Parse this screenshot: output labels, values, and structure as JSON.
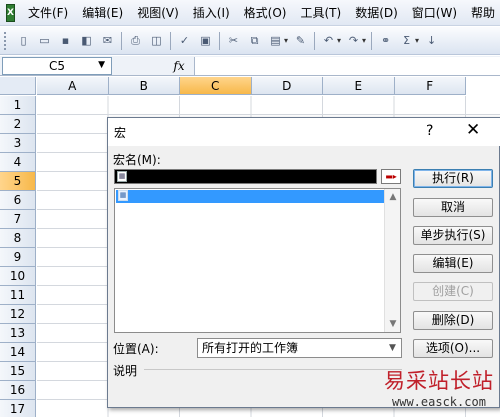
{
  "menubar": {
    "items": [
      "文件(F)",
      "编辑(E)",
      "视图(V)",
      "插入(I)",
      "格式(O)",
      "工具(T)",
      "数据(D)",
      "窗口(W)",
      "帮助"
    ]
  },
  "formula_bar": {
    "name_box": "C5",
    "fx_label": "fx"
  },
  "sheet": {
    "columns": [
      "A",
      "B",
      "C",
      "D",
      "E",
      "F"
    ],
    "rows": [
      "1",
      "2",
      "3",
      "4",
      "5",
      "6",
      "7",
      "8",
      "9",
      "10",
      "11",
      "12",
      "13",
      "14",
      "15",
      "16",
      "17"
    ],
    "active_column": "C",
    "active_row": "5"
  },
  "dialog": {
    "title": "宏",
    "help": "?",
    "close": "✕",
    "macro_name_label": "宏名(M):",
    "location_label": "位置(A):",
    "location_value": "所有打开的工作簿",
    "description_label": "说明",
    "buttons": {
      "run": "执行(R)",
      "cancel": "取消",
      "step_into": "单步执行(S)",
      "edit": "编辑(E)",
      "create": "创建(C)",
      "delete": "删除(D)",
      "options": "选项(O)..."
    }
  },
  "watermark": {
    "brand": "易采站长站",
    "url": "www.easck.com"
  }
}
